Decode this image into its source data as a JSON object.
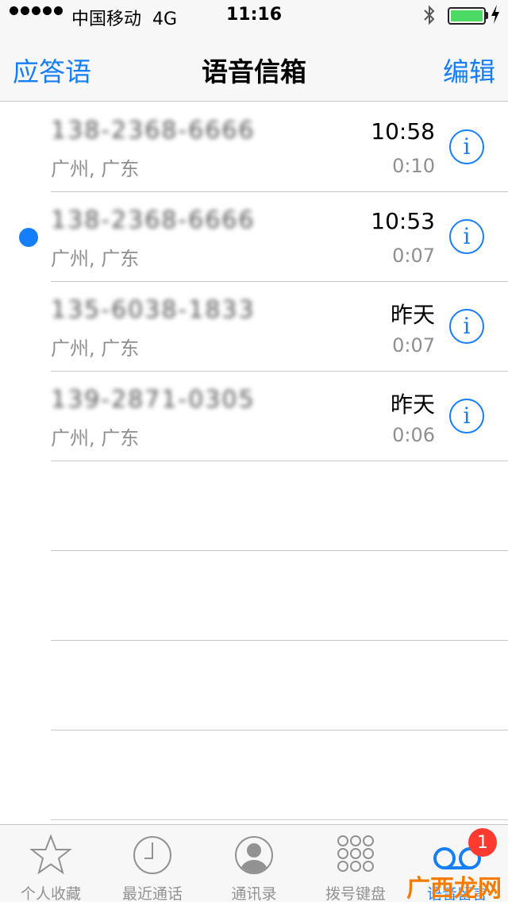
{
  "status_bar": {
    "carrier": "中国移动",
    "network": "4G",
    "time": "11:16",
    "battery_level": 1.0,
    "battery_color": "#4cd964"
  },
  "nav": {
    "left_label": "应答语",
    "title": "语音信箱",
    "right_label": "编辑"
  },
  "voicemails": [
    {
      "caller": "138-2368-6666",
      "location": "广州, 广东",
      "when": "10:58",
      "duration": "0:10",
      "unread": false
    },
    {
      "caller": "138-2368-6666",
      "location": "广州, 广东",
      "when": "10:53",
      "duration": "0:07",
      "unread": true
    },
    {
      "caller": "135-6038-1833",
      "location": "广州, 广东",
      "when": "昨天",
      "duration": "0:07",
      "unread": false
    },
    {
      "caller": "139-2871-0305",
      "location": "广州, 广东",
      "when": "昨天",
      "duration": "0:06",
      "unread": false
    }
  ],
  "tabs": [
    {
      "label": "个人收藏",
      "icon": "star-icon"
    },
    {
      "label": "最近通话",
      "icon": "clock-icon"
    },
    {
      "label": "通讯录",
      "icon": "contacts-icon"
    },
    {
      "label": "拨号键盘",
      "icon": "keypad-icon"
    },
    {
      "label": "语音留言",
      "icon": "voicemail-icon",
      "badge": "1",
      "active": true
    }
  ],
  "watermark": "广西龙网",
  "colors": {
    "accent": "#157efb",
    "badge": "#ff3b30"
  }
}
